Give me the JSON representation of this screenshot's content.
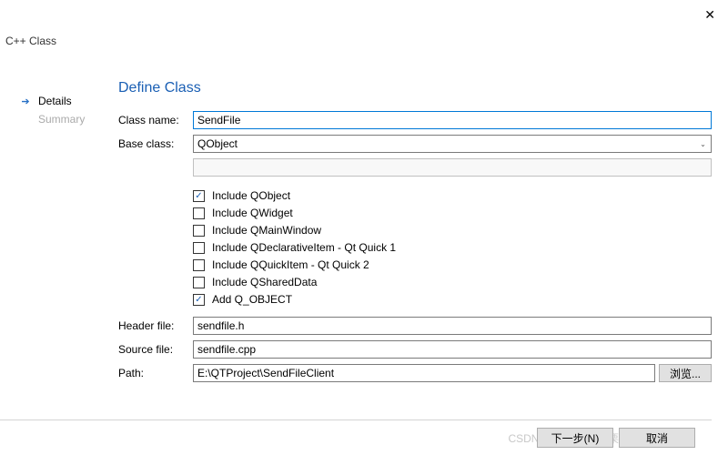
{
  "window": {
    "title": "C++ Class"
  },
  "nav": {
    "items": [
      {
        "label": "Details",
        "active": true
      },
      {
        "label": "Summary",
        "active": false
      }
    ]
  },
  "section": {
    "title": "Define Class"
  },
  "form": {
    "class_name_label": "Class name:",
    "class_name_value": "SendFile",
    "base_class_label": "Base class:",
    "base_class_value": "QObject",
    "header_label": "Header file:",
    "header_value": "sendfile.h",
    "source_label": "Source file:",
    "source_value": "sendfile.cpp",
    "path_label": "Path:",
    "path_value": "E:\\QTProject\\SendFileClient",
    "browse_label": "浏览..."
  },
  "checks": [
    {
      "label": "Include QObject",
      "checked": true
    },
    {
      "label": "Include QWidget",
      "checked": false
    },
    {
      "label": "Include QMainWindow",
      "checked": false
    },
    {
      "label": "Include QDeclarativeItem - Qt Quick 1",
      "checked": false
    },
    {
      "label": "Include QQuickItem - Qt Quick 2",
      "checked": false
    },
    {
      "label": "Include QSharedData",
      "checked": false
    },
    {
      "label": "Add Q_OBJECT",
      "checked": true
    }
  ],
  "footer": {
    "next": "下一步(N)",
    "cancel": "取消"
  },
  "watermark": "CSDN @邓师傅炒板栗"
}
